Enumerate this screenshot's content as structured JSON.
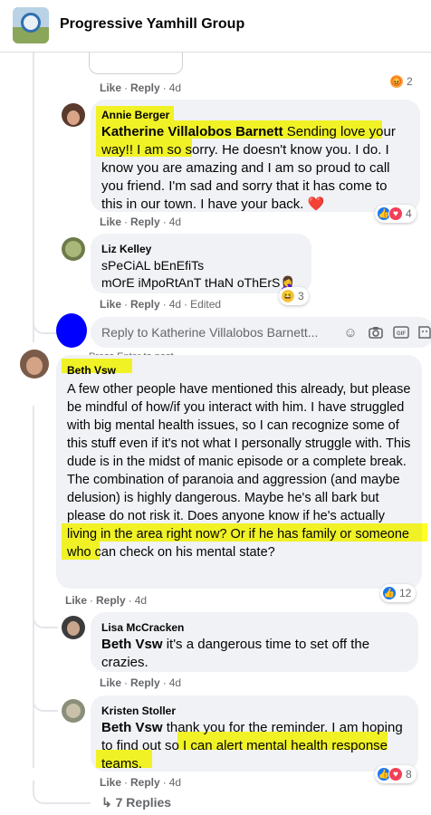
{
  "header": {
    "group_name": "Progressive Yamhill Group"
  },
  "actions": {
    "like": "Like",
    "reply": "Reply",
    "sep": "·"
  },
  "top_comment": {
    "time": "4d",
    "reaction_count": "2"
  },
  "annie": {
    "author": "Annie Berger",
    "mention": "Katherine Villalobos Barnett",
    "text": "Sending love your way!! I am so sorry. He doesn't know you. I do. I know you are amazing and I am so proud to call you friend. I'm sad and sorry that it has come to this in our town. I have your back.",
    "emoji": "❤️",
    "time": "4d",
    "reaction_count": "4"
  },
  "liz": {
    "author": "Liz Kelley",
    "line1": "sPeCiAL bEnEfiTs",
    "line2": "mOrE iMpoRtAnT tHaN oThErS",
    "emoji": "🤦‍♀️",
    "time": "4d",
    "edited": "Edited",
    "reaction_count": "3"
  },
  "reply_box": {
    "placeholder": "Reply to Katherine Villalobos Barnett...",
    "hint": "Press Enter to post."
  },
  "beth": {
    "author": "Beth Vsw",
    "text": "A few other people have mentioned this already, but please be mindful of how/if you interact with him. I have struggled with big mental health issues, so I can recognize some of this stuff even if it's not what I personally struggle with. This dude is in the midst of manic episode or a complete break. The combination of paranoia and aggression (and maybe delusion) is highly dangerous. Maybe he's all bark but please do not risk it. Does anyone know if he's actually living in the area right now? Or if he has family or someone who can check on his mental state?",
    "time": "4d",
    "reaction_count": "12"
  },
  "lisa": {
    "author": "Lisa McCracken",
    "mention": "Beth Vsw",
    "text": "it's a dangerous time to set off the crazies.",
    "time": "4d"
  },
  "kristen": {
    "author": "Kristen Stoller",
    "mention": "Beth Vsw",
    "text": "thank you for the reminder. I am hoping to find out so I can alert mental health response teams.",
    "time": "4d",
    "reaction_count": "8"
  },
  "view_replies": "↳ 7 Replies",
  "icons": [
    "emoji-icon",
    "camera-icon",
    "gif-icon",
    "sticker-icon"
  ],
  "colors": {
    "highlight": "#ffff00",
    "link": "#65676b",
    "bubble": "#f0f2f5",
    "like_blue": "#1877f2"
  }
}
